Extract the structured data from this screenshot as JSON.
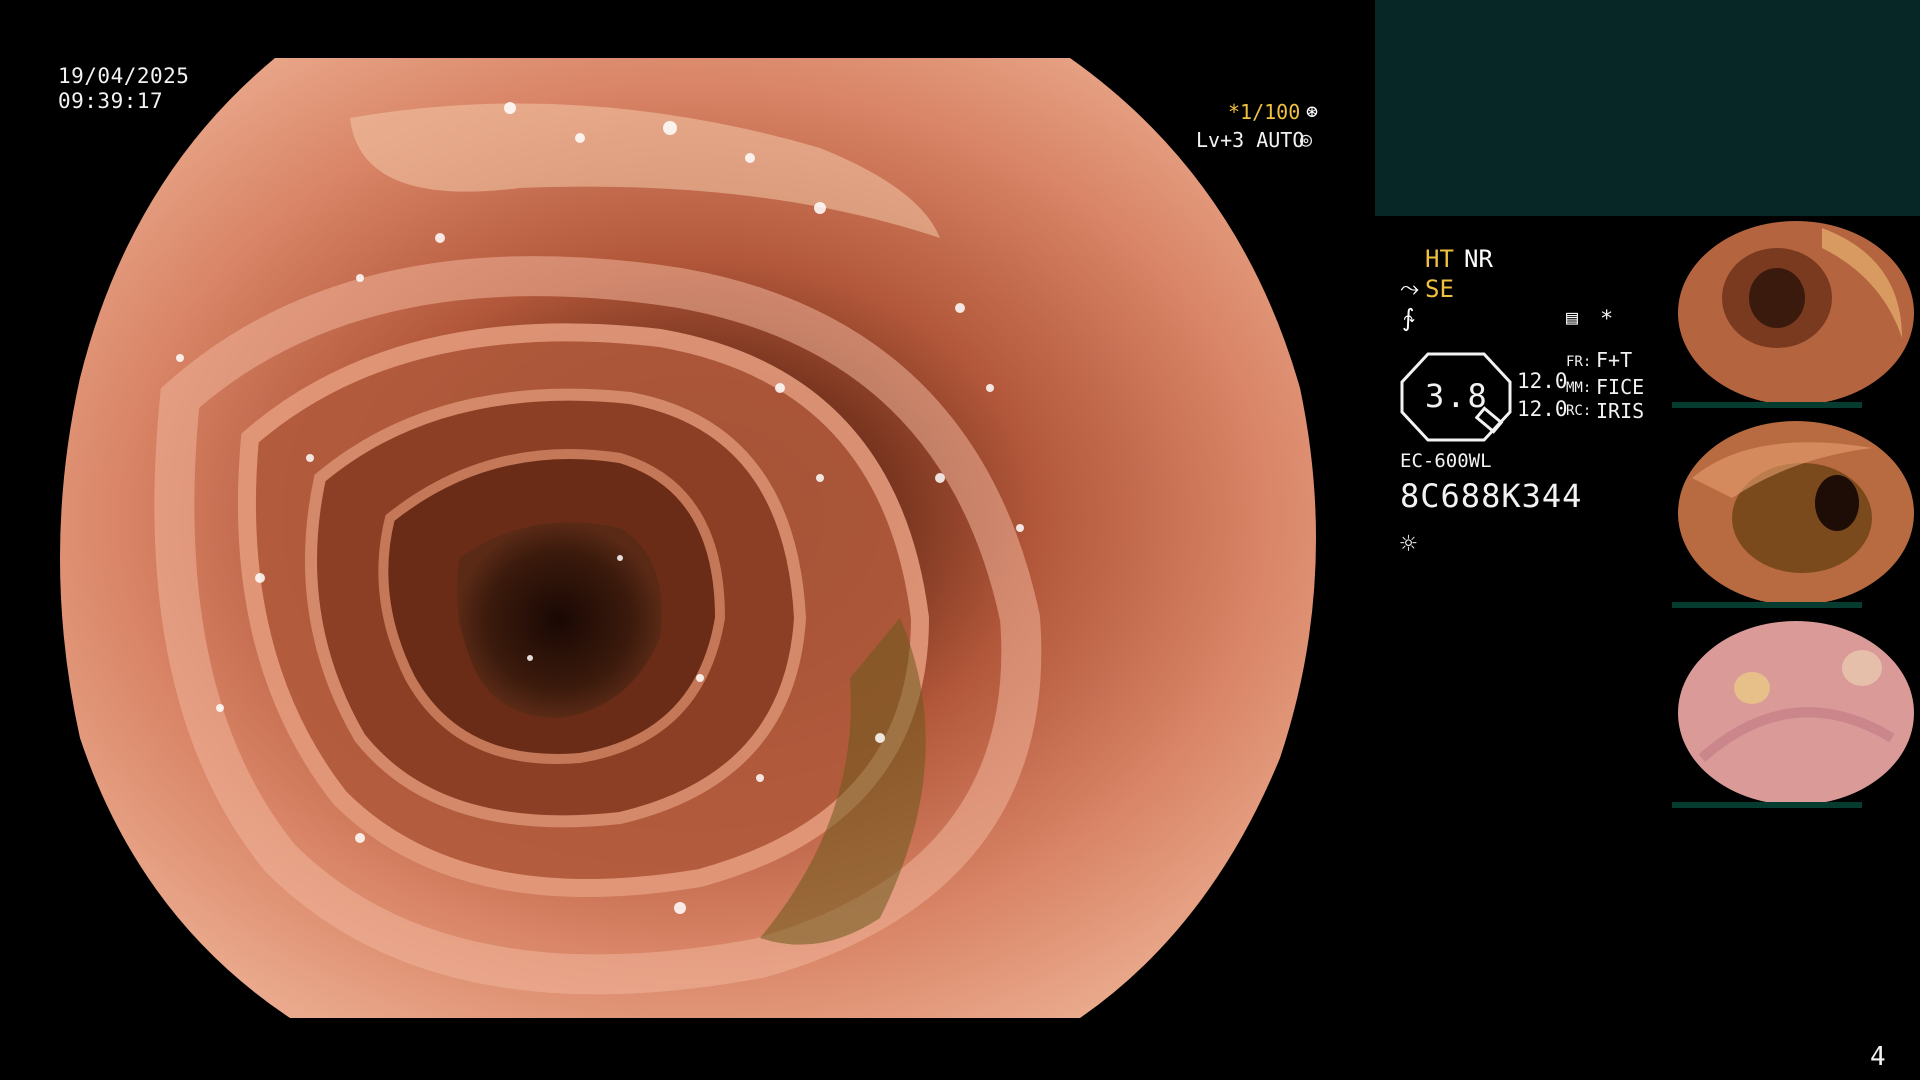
{
  "osd": {
    "date": "19/04/2025",
    "time": "09:39:17",
    "shutter": "*1/100",
    "shutter_icon": "aperture-icon",
    "level": "Lv+3 AUTO",
    "iris_icon": "iris-icon"
  },
  "panel": {
    "ht": "HT",
    "nr": "NR",
    "se": "SE",
    "zoom": "3.8",
    "fr_label": "FR:",
    "mm_label": "MM:",
    "rc_label": "RC:",
    "fr_value": "F+T",
    "mm_value": "FICE",
    "rc_value": "IRIS",
    "value_1": "12.0",
    "value_2": "12.0",
    "star": "*",
    "model": "EC-600WL",
    "serial": "8C688K344"
  },
  "icons": {
    "se_icon": "hand-icon",
    "pen_icon": "pen-icon",
    "doc_icon": "document-icon",
    "light_icon": "light-icon"
  },
  "page_number": "4",
  "colors": {
    "accent_yellow": "#f0c040",
    "teal_panel": "#062726",
    "text": "#f2f2f2"
  }
}
